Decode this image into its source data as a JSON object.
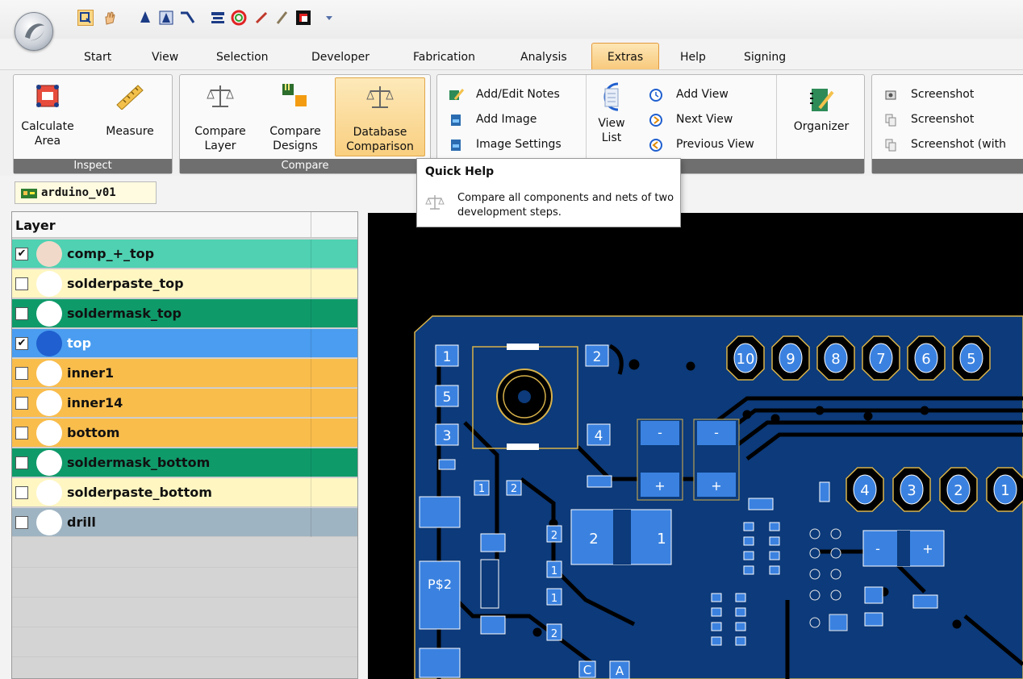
{
  "tabs": [
    {
      "label": "Start"
    },
    {
      "label": "View"
    },
    {
      "label": "Selection"
    },
    {
      "label": "Developer"
    },
    {
      "label": "Fabrication"
    },
    {
      "label": "Analysis"
    },
    {
      "label": "Extras"
    },
    {
      "label": "Help"
    },
    {
      "label": "Signing"
    }
  ],
  "ribbon": {
    "inspect": {
      "footer": "Inspect",
      "calculate_area": "Calculate Area",
      "measure": "Measure"
    },
    "compare": {
      "footer": "Compare",
      "compare_layer": "Compare Layer",
      "compare_designs": "Compare Designs",
      "database_comparison": "Database Comparison"
    },
    "notes": {
      "add_edit_notes": "Add/Edit Notes",
      "add_image": "Add Image",
      "image_settings": "Image Settings",
      "view_list": "View List",
      "add_view": "Add View",
      "next_view": "Next View",
      "previous_view": "Previous View",
      "organizer": "Organizer"
    },
    "screenshot": {
      "item1": "Screenshot",
      "item2": "Screenshot",
      "item3": "Screenshot (with"
    }
  },
  "tooltip": {
    "title": "Quick Help",
    "text": "Compare all components and nets of two development steps."
  },
  "document_tab": "arduino_v01",
  "layer_panel": {
    "header": "Layer",
    "layers": [
      {
        "name": "comp_+_top",
        "checked": true,
        "color": "#4fd1b2",
        "swatch": "#f1d9c9"
      },
      {
        "name": "solderpaste_top",
        "checked": false,
        "color": "#fff6c2",
        "swatch": "#ffffff"
      },
      {
        "name": "soldermask_top",
        "checked": false,
        "color": "#0f9a6a",
        "swatch": "#ffffff"
      },
      {
        "name": "top",
        "checked": true,
        "color": "#4a9df0",
        "swatch": "#1f5fcf"
      },
      {
        "name": "inner1",
        "checked": false,
        "color": "#f9bd4c",
        "swatch": "#ffffff"
      },
      {
        "name": "inner14",
        "checked": false,
        "color": "#f9bd4c",
        "swatch": "#ffffff"
      },
      {
        "name": "bottom",
        "checked": false,
        "color": "#f9bd4c",
        "swatch": "#ffffff"
      },
      {
        "name": "soldermask_bottom",
        "checked": false,
        "color": "#0f9a6a",
        "swatch": "#ffffff"
      },
      {
        "name": "solderpaste_bottom",
        "checked": false,
        "color": "#fff6c2",
        "swatch": "#ffffff"
      },
      {
        "name": "drill",
        "checked": false,
        "color": "#9fb4c2",
        "swatch": "#ffffff"
      }
    ]
  },
  "pcb": {
    "pads_left": [
      "1",
      "2",
      "5",
      "3",
      "4"
    ],
    "pads_header_top": [
      "10",
      "9",
      "8",
      "7",
      "6",
      "5"
    ],
    "pads_header_mid": [
      "4",
      "3",
      "2",
      "1"
    ],
    "misc_labels": [
      "-",
      "+",
      "P$2",
      "C",
      "A"
    ]
  }
}
